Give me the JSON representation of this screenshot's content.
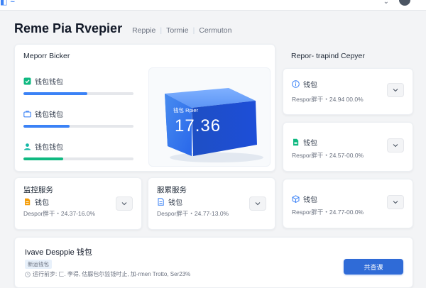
{
  "header": {
    "title": "Reme Pia Rvepier",
    "breadcrumbs": [
      "Reppie",
      "Tormie",
      "Cermuton"
    ]
  },
  "metric_card": {
    "title": "Meporr Bicker",
    "items": [
      {
        "label": "钱包钱包",
        "icon": "checkbox-icon",
        "progress": 0.58,
        "color": "#3b82f6"
      },
      {
        "label": "钱包钱包",
        "icon": "briefcase-icon",
        "progress": 0.42,
        "color": "#3b82f6"
      },
      {
        "label": "钱包钱包",
        "icon": "user-icon",
        "progress": 0.36,
        "color": "#10b981"
      }
    ]
  },
  "hero": {
    "caption": "钱包 Rpier",
    "value": "17.36",
    "color": "#3b82f6"
  },
  "report_panel": {
    "title": "Repor- trapind Cepyer",
    "items": [
      {
        "name": "钱包",
        "icon": "info-icon",
        "meta": "Respor胖干・24.94 00.0%"
      },
      {
        "name": "钱包",
        "icon": "file-icon",
        "meta": "Respor胖干・24.57-00.0%"
      },
      {
        "name": "钱包",
        "icon": "box-icon",
        "meta": "Respor胖干・24.77-00.0%"
      }
    ]
  },
  "services": [
    {
      "title": "监控服务",
      "name": "钱包",
      "icon": "folder-icon",
      "meta": "Despor胖干・24.37-16.0%"
    },
    {
      "title": "服累服务",
      "name": "钱包",
      "icon": "doc-icon",
      "meta": "Despor胖干・24.77-13.0%"
    }
  ],
  "bottom": {
    "heading": "Ivave Desppie 钱包",
    "badge": "新运钱包",
    "note": "运行前步: 匚. 李得, 估脲包尔监钱吋止, 加-rmen Trotto, Ser23%",
    "button": "共查课"
  },
  "colors": {
    "accent": "#2f6bd7",
    "blue": "#3b82f6",
    "green": "#10b981"
  }
}
